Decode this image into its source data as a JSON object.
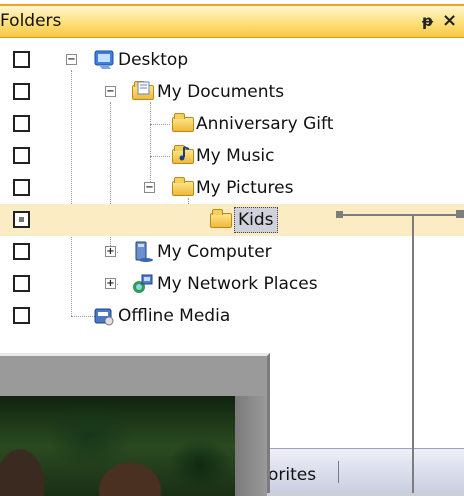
{
  "panel": {
    "title": "Folders",
    "pin_glyph": "ᵽ",
    "close_glyph": "×"
  },
  "tree": [
    {
      "label": "Desktop",
      "icon": "desktop-icon",
      "expander": "−",
      "checked": false
    },
    {
      "label": "My Documents",
      "icon": "documents-folder-icon",
      "expander": "−",
      "checked": false
    },
    {
      "label": "Anniversary Gift",
      "icon": "folder-icon",
      "expander": "",
      "checked": false
    },
    {
      "label": "My Music",
      "icon": "music-folder-icon",
      "expander": "",
      "checked": false
    },
    {
      "label": "My Pictures",
      "icon": "folder-icon",
      "expander": "−",
      "checked": false
    },
    {
      "label": "Kids",
      "icon": "open-folder-icon",
      "expander": "",
      "checked": true,
      "selected": true
    },
    {
      "label": "My Computer",
      "icon": "computer-icon",
      "expander": "+",
      "checked": false
    },
    {
      "label": "My Network Places",
      "icon": "network-places-icon",
      "expander": "+",
      "checked": false
    },
    {
      "label": "Offline Media",
      "icon": "offline-media-icon",
      "expander": "",
      "checked": false
    }
  ],
  "bottom_tabs": {
    "favorites_partial": "orites"
  },
  "colors": {
    "title_gradient_top": "#fff6d0",
    "title_gradient_bottom": "#f6c844",
    "selection": "#fbecc4",
    "callout": "#7d7d7d"
  }
}
